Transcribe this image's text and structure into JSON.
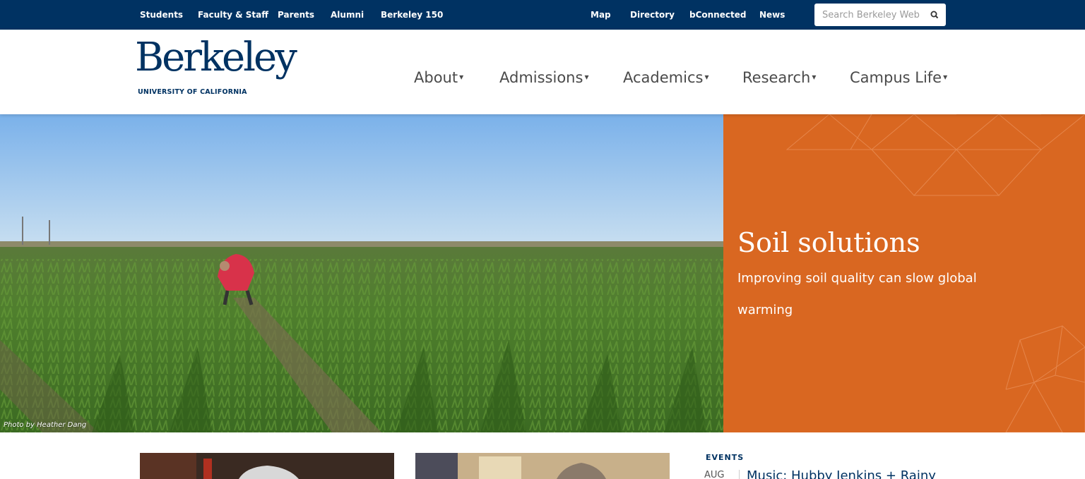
{
  "utility_nav": {
    "left_links": [
      "Students",
      "Faculty & Staff",
      "Parents",
      "Alumni",
      "Berkeley 150"
    ],
    "right_links": [
      "Map",
      "Directory",
      "bConnected",
      "News"
    ],
    "search_placeholder": "Search Berkeley Web"
  },
  "header": {
    "logo_word": "Berkeley",
    "logo_sub": "UNIVERSITY OF CALIFORNIA",
    "nav": [
      "About",
      "Admissions",
      "Academics",
      "Research",
      "Campus Life"
    ]
  },
  "hero": {
    "title": "Soil solutions",
    "subtitle": "Improving soil quality can slow global warming",
    "photo_credit": "Photo by Heather Dang",
    "panel_color": "#d96721"
  },
  "events": {
    "label": "EVENTS",
    "items": [
      {
        "month": "AUG",
        "title": "Music: Hubby Jenkins + Rainy"
      }
    ]
  },
  "colors": {
    "berkeley_blue": "#003262",
    "orange": "#d96721"
  }
}
